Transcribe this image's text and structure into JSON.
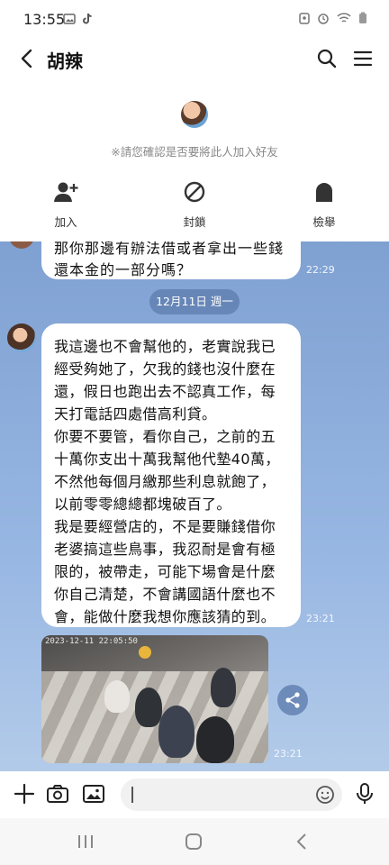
{
  "status_bar": {
    "time": "13:55"
  },
  "header": {
    "title": "胡辣"
  },
  "friend_bar": {
    "notice": "※請您確認是否要將此人加入好友",
    "actions": {
      "add": "加入",
      "block": "封鎖",
      "report": "檢舉"
    }
  },
  "chat": {
    "messages": [
      {
        "lines": [
          "那你那邊有辦法借或者拿出一些錢",
          "還本金的一部分嗎？"
        ],
        "time": "22:29"
      },
      {
        "date_separator": "12月11日 週一"
      },
      {
        "lines": [
          "我這邊也不會幫他的，老實說我已",
          "經受夠她了，欠我的錢也沒什麼在",
          "還，假日也跑出去不認真工作，每",
          "天打電話四處借高利貸。",
          "你要不要管，看你自己，之前的五",
          "十萬你支出十萬我幫他代墊40萬，",
          "不然他每個月繳那些利息就飽了，",
          "以前零零總總都塊破百了。",
          "我是要經營店的，不是要賺錢借你",
          "老婆搞這些鳥事，我忍耐是會有極",
          "限的，被帶走，可能下場會是什麼",
          "你自己清楚，不會講國語什麼也不",
          "會，能做什麼我想你應該猜的到。"
        ],
        "time": "23:21"
      },
      {
        "image": {
          "timestamp_overlay": "2023-12-11 22:05:50"
        },
        "time": "23:21"
      }
    ]
  },
  "colors": {
    "chat_bg": "#8fb0df",
    "bubble": "#ffffff",
    "accent": "#222222"
  }
}
